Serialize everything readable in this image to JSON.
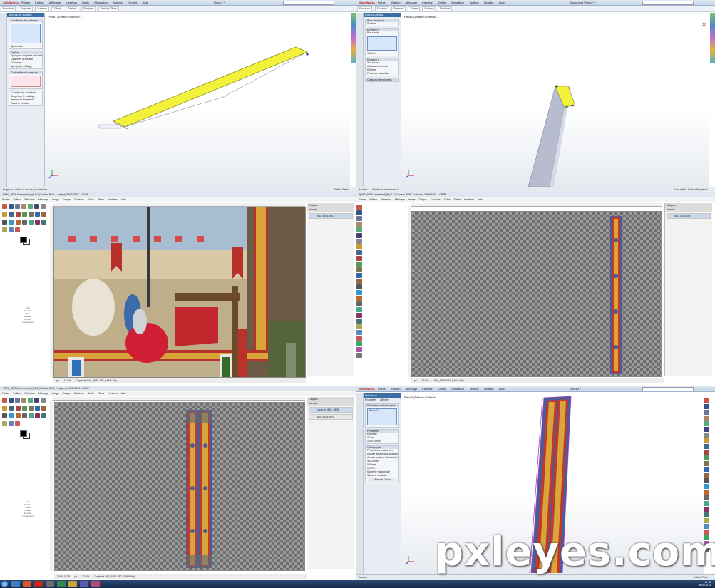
{
  "solidworks": {
    "logo": "SolidWorks",
    "menu": [
      "Fichier",
      "Edition",
      "Affichage",
      "Insertion",
      "Outils",
      "Simulation",
      "Toolbox",
      "Fenêtre",
      "Aide"
    ],
    "tabs": [
      "Fonctions",
      "Esquisse",
      "Surfaces",
      "Tôlerie",
      "Evaluer",
      "DimXpert",
      "Produits Office"
    ],
    "search_placeholder": "Rechercher des fichiers et modèles",
    "left": {
      "window_title": "Pièce1 *",
      "panel_title": "Arrondi de surface",
      "tree_label": "Pièce1 (Défaut<<Défaut>...",
      "groups": [
        "Conditions des surfaces",
        "Options",
        "Contraintes de courbure"
      ],
      "options": [
        "Appliquer à la place de l'arête",
        "Optimiser la surface",
        "Fusionner",
        "Aperçu du maillage"
      ],
      "display_opts": [
        "Courbes des frontières",
        "Supprimer le maillage",
        "Aperçu de fermeture",
        "Ouvrir le résultat"
      ],
      "button": "Ajuster les"
    },
    "right": {
      "window_title": "Document Pièce2 *",
      "panel_title": "Pièce2 Défaut",
      "tree_label": "Pièce2 (Défaut<<Défaut>...",
      "groups": [
        "Plan d'esquisse",
        "Direction 1",
        "Direction 2",
        "Contours sélectionnés"
      ],
      "options": [
        "Surface",
        "Plat simple",
        "Aux faces",
        "Contour non fermé",
        "Pente sur la surface"
      ],
      "dims": [
        "1.25mm",
        "6.00mm"
      ]
    },
    "status_left": "Rogne la surface ou le bas pour la lisser",
    "status_right": "Edition Pièce",
    "status_right_extra": [
      "Sous-défini",
      "Edition Esquisse1"
    ],
    "model_tabs": [
      "Modèle",
      "Etude de mouvement 1"
    ]
  },
  "gimp": {
    "window_title_1": "*[IMG_5876 Armement] (lié)-1.0 (Couleur RVB, 1 calque) 3968x2976 – GIMP",
    "window_title_2": "*[IMG_5876 Armement] (lié)-1.0 (Couleur RVB, 2 calques) 2968x2976 – GIMP",
    "window_title_3": "*[IMG_5876 Armement] (lié)-1.0 (Couleur RVB, 2 calques) 3968x2976 – GIMP",
    "menu": [
      "Fichier",
      "Edition",
      "Sélection",
      "Affichage",
      "Image",
      "Calque",
      "Couleurs",
      "Outils",
      "Filtres",
      "Fenêtres",
      "Aide"
    ],
    "layer_panel_title": "Calques",
    "layer_mode": "Normal",
    "opacity_label": "Opacité",
    "layers_1": [
      "IMG_5876.JPG"
    ],
    "layers_2": [
      "IMG_5876.JPG"
    ],
    "layers_3": [
      "Copie de IMG_5876",
      "IMG_5876.JPG"
    ],
    "status_1": "Copie de IMG_5876.JPG (169.6 Mo)",
    "status_2": "IMG_5876.JPG (169.6 Mo)",
    "status_3": "Copie de IMG_5876.JPG (169.6 Mo)",
    "zoom": "12.5%",
    "unit": "px",
    "coords_3": "1048, 1828",
    "tool_options": [
      "Flou",
      "Netteté",
      "Mode",
      "Opacité",
      "Flou de mouvement"
    ]
  },
  "solidworks_bottom": {
    "window_title": "Pièce3 *",
    "tree_label": "Pièce3 (Défaut<<Défaut>...",
    "panel_title": "Décalque",
    "tabs": [
      "Propriétés",
      "Afficher"
    ],
    "groups": [
      "Projections sélectionnées",
      "Orientation",
      "Apparence",
      "Propriétés",
      "Cartographie"
    ],
    "list_item": "Face<1>",
    "values": [
      "Etiquette",
      "0.1m²",
      "1000.00mm",
      "300.00mm",
      "0.00mm",
      "1.7478"
    ],
    "checks": [
      "Proportions conservées",
      "Ajuster largeur à la sélection",
      "Ajuster hauteur à la sélection",
      "Symétrie horizontale",
      "Symétrie verticale"
    ],
    "button": "Annuler Décalc",
    "status": "Edition Pièce"
  },
  "taskbar": {
    "time": "11:18",
    "date": "28/09/2013"
  },
  "watermark": "pxleyes.com",
  "colors": {
    "solidworks_blue": "#3a6ea5",
    "surface_yellow": "#f2f23a",
    "banner_red": "#b8312a",
    "banner_gold": "#d9a53a",
    "banner_blue": "#4a5c9a",
    "taskbar": "#1f3558"
  }
}
